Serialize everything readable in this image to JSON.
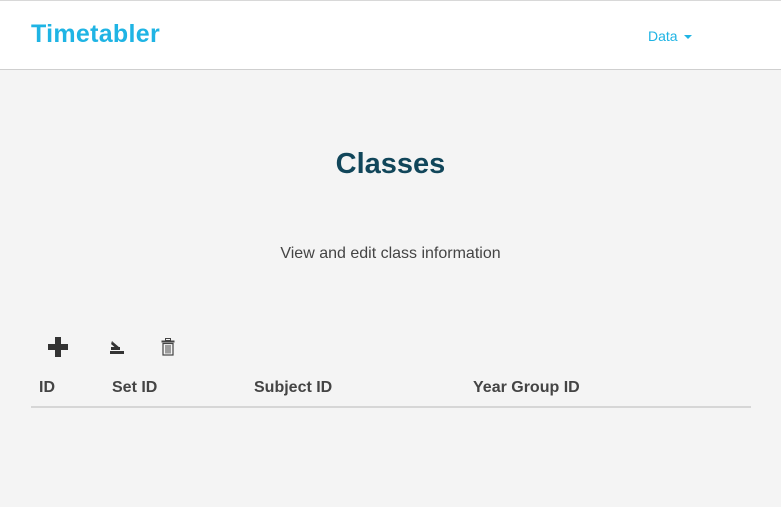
{
  "app": {
    "brand": "Timetabler"
  },
  "nav": {
    "data_menu_label": "Data"
  },
  "page": {
    "title": "Classes",
    "subtitle": "View and edit class information"
  },
  "toolbar": {
    "buttons": [
      {
        "icon": "plus-icon"
      },
      {
        "icon": "edit-icon"
      },
      {
        "icon": "trash-icon"
      }
    ]
  },
  "table": {
    "columns": [
      "ID",
      "Set ID",
      "Subject ID",
      "Year Group ID"
    ],
    "rows": []
  },
  "colors": {
    "brand": "#1fb4e4",
    "title": "#11465a",
    "background": "#f4f4f4",
    "text": "#444444"
  }
}
